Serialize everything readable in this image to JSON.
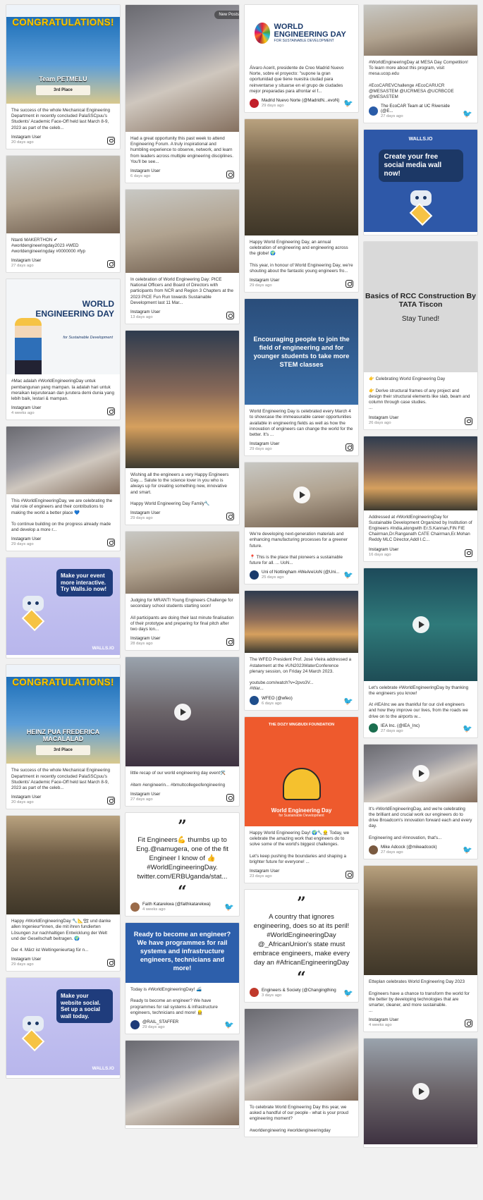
{
  "new_posts_label": "New Posts",
  "columns": [
    [
      {
        "kind": "congrats",
        "poster": {
          "title": "CONGRATULATIONS!",
          "team": "Team PETMELU",
          "place": "3rd Place"
        },
        "text": "The success of the whole Mechanical Engineering Department in recently concluded PalaSSCpuu's Students' Academic Face-Off held last March 8-9, 2023 as part of the celeb...",
        "author": "Instagram User",
        "time": "20 days ago",
        "network": "instagram"
      },
      {
        "kind": "photo",
        "photo": "photo-c",
        "h": 110,
        "text": "Ntanti MAKERTHON ✔\n#worldengineeringday2023 #WED\n#worldengineeringday #0000000 #fyp",
        "author": "Instagram User",
        "time": "27 days ago",
        "network": "instagram"
      },
      {
        "kind": "wedposter",
        "poster": {
          "title": "WORLD ENGINEERING DAY",
          "sub": "for Sustainable Development"
        },
        "text": "#Mac adalah #WorldEngineeringDay untuk pembangunan yang mampan. Ia adalah hari untuk meraikan kejuruteraan dan jurutera demi dunia yang lebih baik, lestari & mampan.",
        "author": "Instagram User",
        "time": "4 weeks ago",
        "network": "instagram"
      },
      {
        "kind": "photo",
        "photo": "photo-a",
        "h": 96,
        "text": "This #WorldEngineeringDay, we are celebrating the vital role of engineers and their contributions to making the world a better place 💙\n\nTo continue building on the progress already made and develop a more r...",
        "author": "Instagram User",
        "time": "29 days ago",
        "network": "instagram"
      },
      {
        "kind": "lilac",
        "poster": {
          "bubble": "Make your event more interactive. Try Walls.io now!",
          "brand": "WALLS.IO"
        }
      },
      {
        "kind": "congrats",
        "poster": {
          "title": "CONGRATULATIONS!",
          "team": "HEINZ PUA FREDERICA MACALALAD",
          "place": "3rd Place"
        },
        "text": "The success of the whole Mechanical Engineering Department in recently concluded PalaSSCpuu's Students' Academic Face-Off held last March 8-9, 2023 as part of the celeb...",
        "author": "Instagram User",
        "time": "20 days ago",
        "network": "instagram"
      },
      {
        "kind": "photo",
        "photo": "photo-d",
        "h": 140,
        "text": "Happy #WorldEngineeringDay 🔧📐🏗 und danke allen Ingenieur*innen, die mit ihren fundierten Lösungen zur nachhaltigen Entwicklung der Welt und der Gesellschaft beitragen. 🌍\n\nDer 4. März ist Weltingenieurtag für n...",
        "author": "Instagram User",
        "time": "29 days ago",
        "network": "instagram"
      },
      {
        "kind": "lilac",
        "poster": {
          "bubble": "Make your website social. Set up a social wall today.",
          "brand": "WALLS.IO"
        }
      }
    ],
    [
      {
        "kind": "photo",
        "photo": "photo-a",
        "h": 180,
        "text": "Had a great opportunity this past week to attend Engineering Forum. A truly inspirational and humbling experience to observe, network, and learn from leaders across multiple engineering disciplines. You'll be see...",
        "author": "Instagram User",
        "time": "6 days ago",
        "network": "instagram"
      },
      {
        "kind": "photo",
        "photo": "photo-c",
        "h": 118,
        "text": "In celebration of World Engineering Day: PICE National Officers and Board of Directors with participants from NCR and Region 3 Chapters at the 2023 PICE Fun Run towards Sustainable Development last 11 Mar...",
        "author": "Instagram User",
        "time": "13 days ago",
        "network": "instagram"
      },
      {
        "kind": "photo",
        "photo": "photo-b",
        "h": 195,
        "text": "Wishing all the engineers a very Happy Engineers Day.... Salute to the science lover in you who is always up for creating something new, innovative and smart.\n\nHappy World Engineering Day Family🔧",
        "author": "Instagram User",
        "time": "29 days ago",
        "network": "instagram"
      },
      {
        "kind": "photo",
        "photo": "photo-c",
        "h": 88,
        "text": "Judging for MRANTI Young Engineers Challenge for secondary school students starting soon!\n\nAll participants are doing their last minute finalisation of their prototype and preparing for final pitch after two days lon...",
        "author": "Instagram User",
        "time": "28 days ago",
        "network": "instagram"
      },
      {
        "kind": "video",
        "photo": "videogray",
        "h": 155,
        "text": "little recap of our world engineering day event🛠️\n\n#item #engineerin... #bmultcollegeofengineering",
        "author": "Instagram User",
        "time": "27 days ago",
        "network": "instagram"
      },
      {
        "kind": "quote",
        "quote": "Fit Engineers💪 thumbs up to Eng.@namugera, one of the fit Engineer I know of 👍 #WorldEngineeringDay. twitter.com/ERBUganda/stat...",
        "author": "Faith Katarekwa (@faithkatarekwa)",
        "time": "4 weeks ago",
        "network": "twitter",
        "avatar": "#9a6b4a"
      },
      {
        "kind": "bluepost",
        "poster": "Ready to become an engineer? We have programmes for rail systems and infrastructure engineers, technicians and more!",
        "text": "Today is #WorldEngineeringDay! 🚄\n\nReady to become an engineer? We have programmes for rail systems & infrastructure engineers, technicians and more! 👷‍♀️",
        "author": "@RAIL_STAFFER",
        "time": "29 days ago",
        "network": "twitter",
        "avatar": "#1e3a78"
      },
      {
        "kind": "photo",
        "photo": "photo-a",
        "h": 120,
        "text": "",
        "author": "",
        "time": "",
        "network": ""
      }
    ],
    [
      {
        "kind": "wedlogo",
        "poster": {
          "title": "WORLD ENGINEERING DAY",
          "sub": "FOR SUSTAINABLE DEVELOPMENT"
        },
        "text": "Álvaro Acerit, presidente de Creo Madrid Nuevo Norte, sobre el proyecto: \"supone la gran oportunidad que tiene nuestra ciudad para reinventarse y situarse en el grupo de ciudades mejor preparadas para afrontar el f...",
        "author": "Madrid Nuevo Norte (@MadridN...evoN)",
        "time": "29 days ago",
        "network": "twitter",
        "avatar": "#c21f2a"
      },
      {
        "kind": "photo",
        "photo": "photo-d",
        "h": 165,
        "text": "Happy World Engineering Day, an annual celebration of engineering and engineering across the globe! 🌍\n\nThis year, in honour of World Engineering Day, we're shouting about the fantastic young engineers fro...",
        "author": "Instagram User",
        "time": "29 days ago",
        "network": "instagram"
      },
      {
        "kind": "bluetext",
        "poster": "Encouraging people to join the field of engineering and for younger students to take more STEM classes",
        "text": "World Engineering Day is celebrated every March 4 to showcase the immeasurable career opportunities available in engineering fields as well as how the innovation of engineers can change the world for the better. It's ...",
        "author": "Instagram User",
        "time": "29 days ago",
        "network": "instagram"
      },
      {
        "kind": "video",
        "photo": "photo-c",
        "h": 92,
        "text": "We're developing next-generation materials and enhancing manufacturing processes for a greener future.\n\n📍 This is the place that pioneers a sustainable future for all. ... UoN...",
        "author": "Uni of Nottingham #WeAreUoN (@Uni...",
        "time": "25 days ago",
        "network": "twitter",
        "avatar": "#1a3a6b"
      },
      {
        "kind": "photo",
        "photo": "photo-b",
        "h": 88,
        "text": "The WFEO President Prof. José Vieira addressed a #statement at the #UN2023WaterConference plenary session, on Friday 24 March 2023.\n\nyoutube.com/watch?v=2pvo3V...\n#War...",
        "author": "WFEO (@wfeo)",
        "time": "6 days ago",
        "network": "twitter",
        "avatar": "#1f4e8c"
      },
      {
        "kind": "orange",
        "poster": {
          "brand": "THE DOZY MNGBUDI FOUNDATION",
          "title": "World Engineering Day",
          "sub": "for Sustainable Development"
        },
        "text": "Happy World Engineering Day! 🌍🔧👷 Today, we celebrate the amazing work that engineers do to solve some of the world's biggest challenges.\n\nLet's keep pushing the boundaries and shaping a brighter future for everyone! ...",
        "author": "Instagram User",
        "time": "23 days ago",
        "network": "instagram"
      },
      {
        "kind": "quote",
        "quote": "A country that ignores engineering, does so at its peril! #WorldEngineeringDay @_AfricanUnion's state must embrace engineers, make every day an #AfricanEngineeringDay",
        "author": "Engineers & Society (@Changingthing",
        "time": "3 days ago",
        "network": "twitter",
        "avatar": "#c0392b"
      },
      {
        "kind": "photo",
        "photo": "photo-a",
        "h": 130,
        "text": "To celebrate World Engineering Day this year, we asked a handful of our people - what is your proud engineering moment?\n\n#worldengineering #worldengineeringday",
        "author": "",
        "time": "",
        "network": ""
      }
    ],
    [
      {
        "kind": "photo",
        "photo": "photo-c",
        "h": 72,
        "text": "#WorldEngineeringDay at MESA Day Competition! To learn more about this program, visit mesa.ucop.edu\n\n#EcoCAREVChallenge #EcoCARUCR @MESASTEM @UCRMESA @UCRBCOE @MESASTEM",
        "author": "The EcoCAR Team at UC Riverside (@E...",
        "time": "27 days ago",
        "network": "twitter",
        "avatar": "#2a5ca8"
      },
      {
        "kind": "walls",
        "poster": {
          "bubble": "Create your free social media wall now!",
          "brand": "WALLS.IO"
        }
      },
      {
        "kind": "rcc",
        "poster": {
          "title": "Basics of RCC Construction By TATA Tiscon",
          "sub": "Stay Tuned!"
        },
        "text": "👉 Celebrating World Engineering Day\n\n👉 Derive structural frames of any project and design their structural elements like slab, beam and column through case studies.\n...",
        "author": "Instagram User",
        "time": "26 days ago",
        "network": "instagram"
      },
      {
        "kind": "photo",
        "photo": "photo-b",
        "h": 105,
        "text": "Addressed at #WorldEngineeringDay for Sustainable Development Organized by Institution of Engineers #India,alongwith Er.S.Kannan,FIN FIE Chairman,Dr.Ranganath CATE Chairman,Er.Mohan Reddy MLC Director,Addl I.C...",
        "author": "Instagram User",
        "time": "16 days ago",
        "network": "instagram"
      },
      {
        "kind": "video",
        "photo": "videoteal",
        "h": 160,
        "text": "Let's celebrate #WorldEngineeringDay by thanking the engineers you know!\n\nAt #IEAInc we are thankful for our civil engineers and how they improve our lives, from the roads we drive on to the airports w...",
        "author": "IEA Inc. (@IEA_Inc)",
        "time": "27 days ago",
        "network": "twitter",
        "avatar": "#1b6e4f"
      },
      {
        "kind": "video",
        "photo": "photo-a",
        "h": 82,
        "text": "It's #WorldEngineeringDay, and we're celebrating the brilliant and crucial work our engineers do to drive Broadcom's innovation forward each and every day.\n\nEngineering and #innovation, that's...",
        "author": "Mike Adcock (@mikeadcock)",
        "time": "27 days ago",
        "network": "twitter",
        "avatar": "#7a5a40"
      },
      {
        "kind": "photo",
        "photo": "photo-d",
        "h": 155,
        "text": "Etteplan celebrates World Engineering Day 2023\n\nEngineers have a chance to transform the world for the better by developing technologies that are smarter, cleaner, and more sustainable.\n...",
        "author": "Instagram User",
        "time": "4 weeks ago",
        "network": "instagram"
      },
      {
        "kind": "video",
        "photo": "videogray",
        "h": 150,
        "text": "",
        "author": "",
        "time": "",
        "network": ""
      }
    ]
  ]
}
